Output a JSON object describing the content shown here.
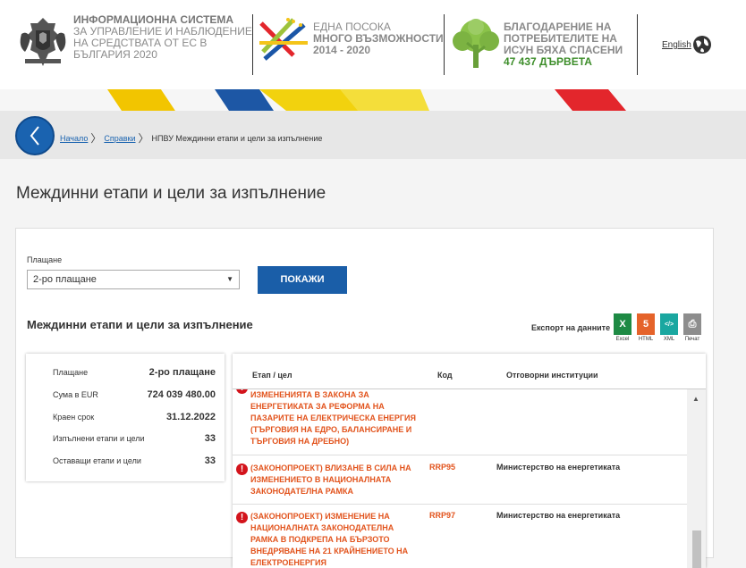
{
  "header": {
    "system_title_bold": "ИНФОРМАЦИОННА СИСТЕМА",
    "system_title_rest": "ЗА УПРАВЛЕНИЕ И НАБЛЮДЕНИЕ НА СРЕДСТВАТА ОТ ЕС В БЪЛГАРИЯ 2020",
    "eu_line1": "ЕДНА ПОСОКА",
    "eu_line2": "МНОГО ВЪЗМОЖНОСТИ 2014 - 2020",
    "tree_line": "БЛАГОДАРЕНИЕ НА ПОТРЕБИТЕЛИТЕ НА ИСУН БЯХА СПАСЕНИ",
    "tree_count": "47 437",
    "tree_suffix": "ДЪРВЕТА",
    "language": "English"
  },
  "breadcrumb": {
    "home": "Начало",
    "reports": "Справки",
    "current": "НПВУ Междинни етапи и цели за изпълнение"
  },
  "page": {
    "title": "Междинни етапи и цели за изпълнение"
  },
  "filter": {
    "label": "Плащане",
    "selected": "2-ро плащане",
    "button": "ПОКАЖИ"
  },
  "section": {
    "title": "Междинни етапи и цели за изпълнение",
    "export_label": "Експорт на данните",
    "exports": [
      {
        "label": "Excel",
        "glyph": "X",
        "color": "#1e8a44"
      },
      {
        "label": "HTML",
        "glyph": "5",
        "color": "#e5632a"
      },
      {
        "label": "XML",
        "glyph": "</>",
        "color": "#1aa7a0"
      },
      {
        "label": "Печат",
        "glyph": "⎙",
        "color": "#8d8d8d"
      }
    ]
  },
  "summary": {
    "rows": [
      {
        "label": "Плащане",
        "value": "2-ро плащане"
      },
      {
        "label": "Сума в EUR",
        "value": "724 039 480.00"
      },
      {
        "label": "Краен срок",
        "value": "31.12.2022"
      },
      {
        "label": "Изпълнени етапи и цели",
        "value": "33"
      },
      {
        "label": "Оставащи етапи и цели",
        "value": "33"
      }
    ]
  },
  "table": {
    "headers": {
      "stage": "Етап / цел",
      "code": "Код",
      "institutions": "Отговорни институции"
    },
    "rows": [
      {
        "stage": "ИЗМЕНЕНИЯТА В ЗАКОНА ЗА ЕНЕРГЕТИКАТА ЗА РЕФОРМА НА ПАЗАРИТЕ НА ЕЛЕКТРИЧЕСКА ЕНЕРГИЯ (ТЪРГОВИЯ НА ЕДРО, БАЛАНСИРАНЕ И ТЪРГОВИЯ НА ДРЕБНО)",
        "code": "",
        "institution": ""
      },
      {
        "stage": "(ЗАКОНОПРОЕКТ) ВЛИЗАНЕ В СИЛА НА ИЗМЕНЕНИЕТО В НАЦИОНАЛНАТА ЗАКОНОДАТЕЛНА РАМКА",
        "code": "RRP95",
        "institution": "Министерство на енергетиката"
      },
      {
        "stage": "(ЗАКОНОПРОЕКТ) ИЗМЕНЕНИЕ НА НАЦИОНАЛНАТА ЗАКОНОДАТЕЛНА РАМКА В ПОДКРЕПА НА БЪРЗОТО ВНЕДРЯВАНЕ НА 21 КРАЙНЕНИЕТО НА ЕЛЕКТРОЕНЕРГИЯ",
        "code": "RRP97",
        "institution": "Министерство на енергетиката"
      }
    ]
  }
}
